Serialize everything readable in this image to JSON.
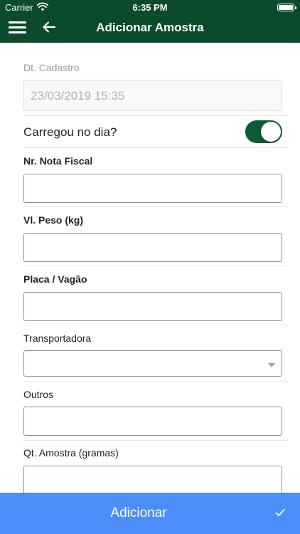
{
  "status_bar": {
    "carrier": "Carrier",
    "time": "6:35 PM"
  },
  "header": {
    "title": "Adicionar Amostra",
    "menu_icon": "hamburger-icon",
    "back_icon": "arrow-left-icon",
    "color": "#0b4a2a"
  },
  "form": {
    "dt_cadastro": {
      "label": "Dt. Cadastro",
      "value": "23/03/2019 15:35"
    },
    "carregou": {
      "label": "Carregou no dia?",
      "checked": true
    },
    "nota_fiscal": {
      "label": "Nr. Nota Fiscal",
      "value": ""
    },
    "peso": {
      "label": "Vl. Peso (kg)",
      "value": ""
    },
    "placa": {
      "label": "Placa / Vagão",
      "value": ""
    },
    "transportadora": {
      "label": "Transportadora",
      "value": ""
    },
    "outros": {
      "label": "Outros",
      "value": ""
    },
    "qt_amostra": {
      "label": "Qt. Amostra (gramas)",
      "value": ""
    }
  },
  "footer": {
    "button_label": "Adicionar",
    "icon": "checkmark-icon",
    "color": "#4c8ef7"
  }
}
